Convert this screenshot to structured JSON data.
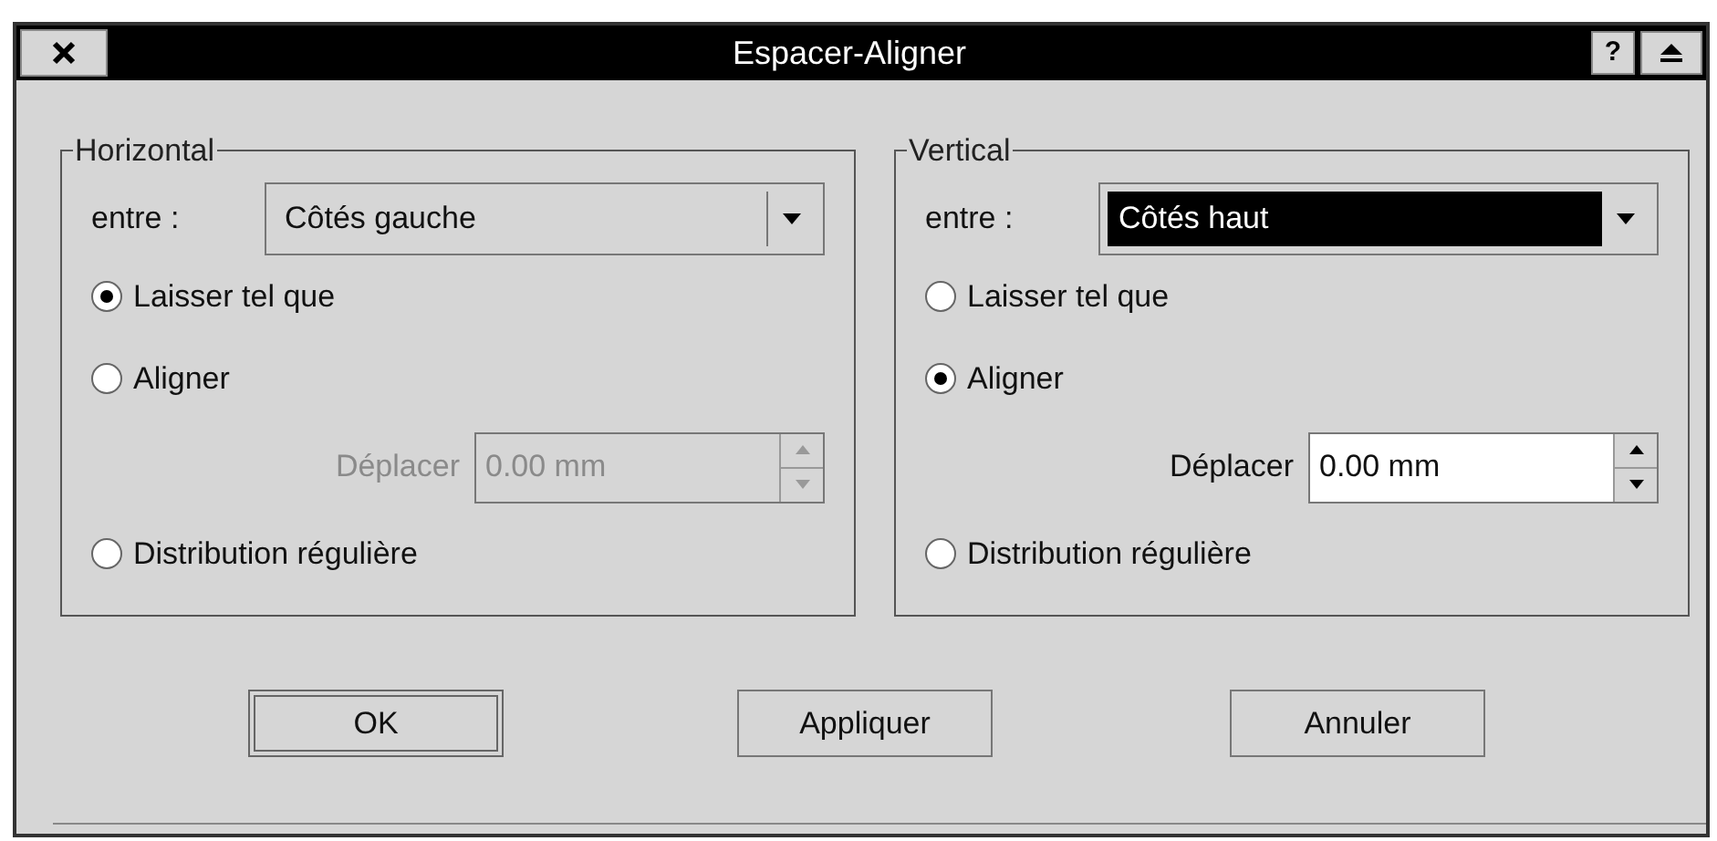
{
  "window": {
    "title": "Espacer-Aligner",
    "help_button": "?"
  },
  "groups": [
    {
      "title": "Horizontal",
      "between_label": "entre :",
      "dropdown": {
        "value": "Côtés gauche",
        "highlighted": false
      },
      "options": [
        {
          "label": "Laisser tel que",
          "selected": true
        },
        {
          "label": "Aligner",
          "selected": false
        },
        {
          "label": "Distribution régulière",
          "selected": false
        }
      ],
      "move": {
        "label": "Déplacer",
        "value": "0.00 mm",
        "disabled": true
      }
    },
    {
      "title": "Vertical",
      "between_label": "entre :",
      "dropdown": {
        "value": "Côtés haut",
        "highlighted": true
      },
      "options": [
        {
          "label": "Laisser tel que",
          "selected": false
        },
        {
          "label": "Aligner",
          "selected": true
        },
        {
          "label": "Distribution régulière",
          "selected": false
        }
      ],
      "move": {
        "label": "Déplacer",
        "value": "0.00 mm",
        "disabled": false
      }
    }
  ],
  "buttons": [
    {
      "label": "OK",
      "default": true
    },
    {
      "label": "Appliquer",
      "default": false
    },
    {
      "label": "Annuler",
      "default": false
    }
  ]
}
